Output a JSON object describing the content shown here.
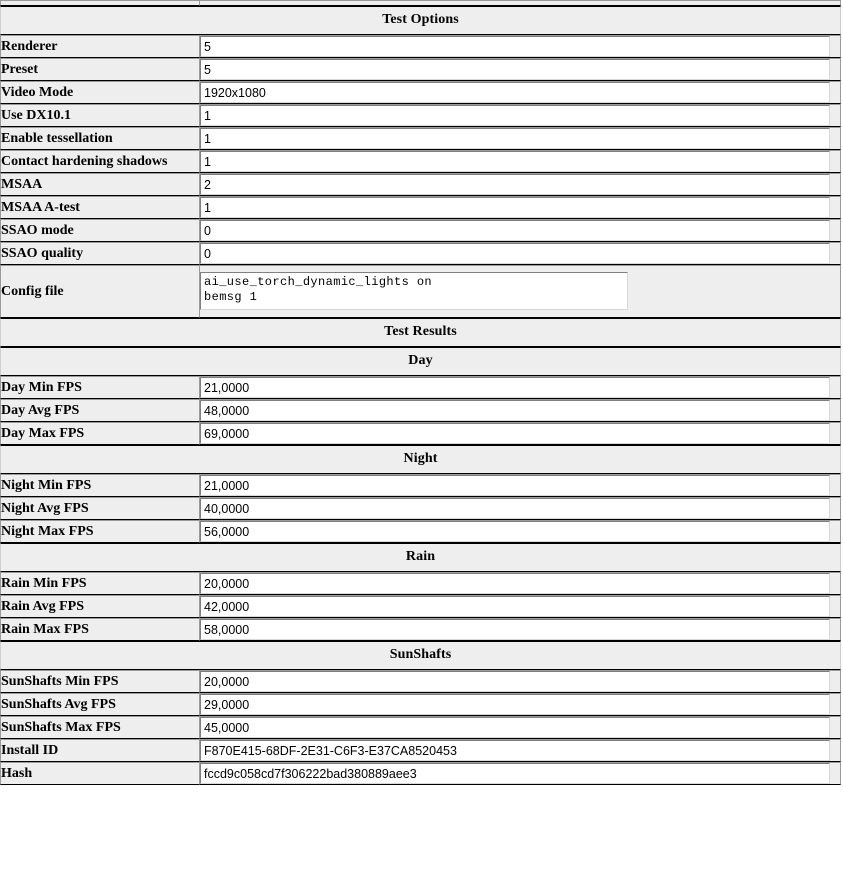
{
  "sections": [
    {
      "id": "test-options",
      "title": "Test Options",
      "rows": [
        {
          "label": "Renderer",
          "value": "5",
          "kind": "input"
        },
        {
          "label": "Preset",
          "value": "5",
          "kind": "input"
        },
        {
          "label": "Video Mode",
          "value": "1920x1080",
          "kind": "input"
        },
        {
          "label": "Use DX10.1",
          "value": "1",
          "kind": "input"
        },
        {
          "label": "Enable tessellation",
          "value": "1",
          "kind": "input"
        },
        {
          "label": "Contact hardening shadows",
          "value": "1",
          "kind": "input"
        },
        {
          "label": "MSAA",
          "value": "2",
          "kind": "input"
        },
        {
          "label": "MSAA A-test",
          "value": "1",
          "kind": "input"
        },
        {
          "label": "SSAO mode",
          "value": "0",
          "kind": "input"
        },
        {
          "label": "SSAO quality",
          "value": "0",
          "kind": "input"
        },
        {
          "label": "Config file",
          "value": "ai_use_torch_dynamic_lights on\nbemsg 1",
          "kind": "textarea"
        }
      ]
    },
    {
      "id": "test-results",
      "title": "Test Results",
      "rows": []
    },
    {
      "id": "day",
      "title": "Day",
      "rows": [
        {
          "label": "Day Min FPS",
          "value": "21,0000",
          "kind": "input"
        },
        {
          "label": "Day Avg FPS",
          "value": "48,0000",
          "kind": "input"
        },
        {
          "label": "Day Max FPS",
          "value": "69,0000",
          "kind": "input"
        }
      ]
    },
    {
      "id": "night",
      "title": "Night",
      "rows": [
        {
          "label": "Night Min FPS",
          "value": "21,0000",
          "kind": "input"
        },
        {
          "label": "Night Avg FPS",
          "value": "40,0000",
          "kind": "input"
        },
        {
          "label": "Night Max FPS",
          "value": "56,0000",
          "kind": "input"
        }
      ]
    },
    {
      "id": "rain",
      "title": "Rain",
      "rows": [
        {
          "label": "Rain Min FPS",
          "value": "20,0000",
          "kind": "input"
        },
        {
          "label": "Rain Avg FPS",
          "value": "42,0000",
          "kind": "input"
        },
        {
          "label": "Rain Max FPS",
          "value": "58,0000",
          "kind": "input"
        }
      ]
    },
    {
      "id": "sunshafts",
      "title": "SunShafts",
      "rows": [
        {
          "label": "SunShafts Min FPS",
          "value": "20,0000",
          "kind": "input"
        },
        {
          "label": "SunShafts Avg FPS",
          "value": "29,0000",
          "kind": "input"
        },
        {
          "label": "SunShafts Max FPS",
          "value": "45,0000",
          "kind": "input"
        },
        {
          "label": "Install ID",
          "value": "F870E415-68DF-2E31-C6F3-E37CA8520453",
          "kind": "input"
        },
        {
          "label": "Hash",
          "value": "fccd9c058cd7f306222bad380889aee3",
          "kind": "input"
        }
      ]
    }
  ],
  "colors": {
    "label_background": "#eeeeee",
    "field_background": "#ffffff",
    "border": "#000000",
    "text": "#000000"
  }
}
